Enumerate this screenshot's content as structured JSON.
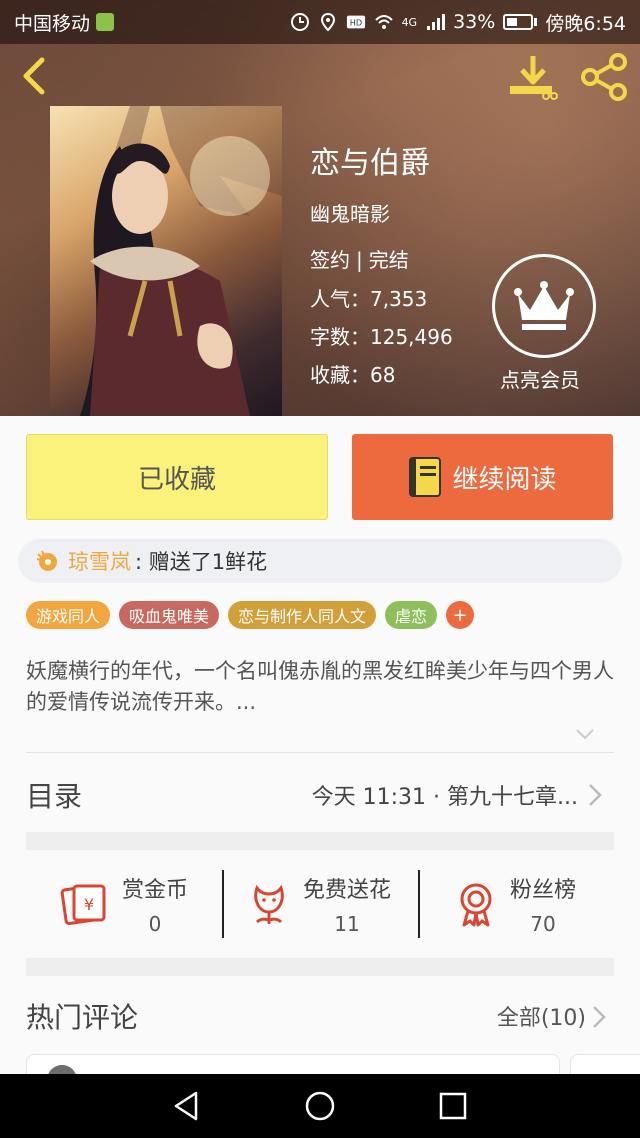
{
  "status_bar": {
    "carrier": "中国移动",
    "battery_percent": "33%",
    "time": "傍晚6:54",
    "network": "4G"
  },
  "book": {
    "title": "恋与伯爵",
    "author": "幽鬼暗影",
    "status_signed": "签约",
    "status_complete": "完结",
    "popularity_label": "人气：",
    "popularity_value": "7,353",
    "word_count_label": "字数：",
    "word_count_value": "125,496",
    "favorites_label": "收藏：",
    "favorites_value": "68"
  },
  "vip": {
    "label": "点亮会员",
    "icon": "crown-icon"
  },
  "actions": {
    "collected_label": "已收藏",
    "continue_label": "继续阅读"
  },
  "gift_feed": {
    "user": "琼雪岚",
    "text": ": 赠送了1鲜花"
  },
  "tags": [
    {
      "label": "游戏同人",
      "color": "#f2a640"
    },
    {
      "label": "吸血鬼唯美",
      "color": "#c7695e"
    },
    {
      "label": "恋与制作人同人文",
      "color": "#d1a03b"
    },
    {
      "label": "虐恋",
      "color": "#8fbf5a"
    }
  ],
  "tag_add_label": "+",
  "summary": "妖魔横行的年代，一个名叫傀赤胤的黑发红眸美少年与四个男人的爱情传说流传开来。...",
  "toc": {
    "title": "目录",
    "latest": "今天 11:31 · 第九十七章..."
  },
  "stats": [
    {
      "label": "赏金币",
      "value": "0",
      "icon": "red-envelope-icon"
    },
    {
      "label": "免费送花",
      "value": "11",
      "icon": "flower-icon"
    },
    {
      "label": "粉丝榜",
      "value": "70",
      "icon": "award-ribbon-icon"
    }
  ],
  "comments": {
    "title": "热门评论",
    "all_label": "全部(10)"
  },
  "colors": {
    "accent_orange": "#ec6a3e",
    "collected_yellow": "#fbf27b",
    "icon_red": "#d9452f"
  }
}
